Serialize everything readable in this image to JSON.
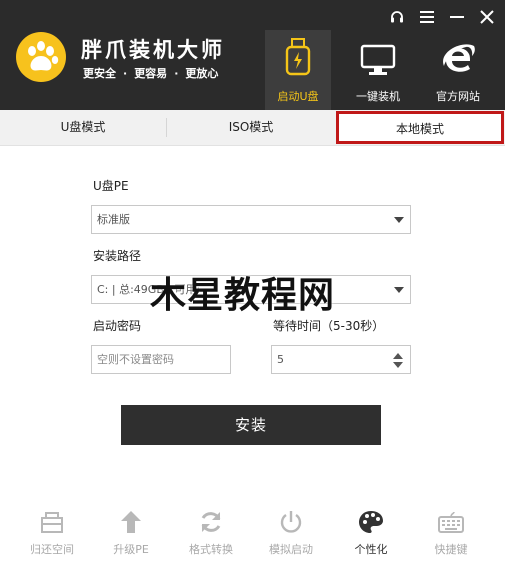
{
  "app": {
    "title": "胖爪装机大师",
    "slogan": [
      "更安全",
      "更容易",
      "更放心"
    ],
    "slogan_separator": "·"
  },
  "window_controls": {
    "support": "headset-icon",
    "menu": "menu-icon",
    "minimize": "minimize-icon",
    "close": "close-icon"
  },
  "nav": [
    {
      "label": "启动U盘",
      "icon": "usb-drive-icon",
      "active": true
    },
    {
      "label": "一键装机",
      "icon": "monitor-icon",
      "active": false
    },
    {
      "label": "官方网站",
      "icon": "ie-browser-icon",
      "active": false
    }
  ],
  "tabs": [
    {
      "label": "U盘模式",
      "active": false
    },
    {
      "label": "ISO模式",
      "active": false
    },
    {
      "label": "本地模式",
      "active": true
    }
  ],
  "form": {
    "pe_label": "U盘PE",
    "pe_value": "标准版",
    "path_label": "安装路径",
    "path_value": "C: | 总:49GB | 可用:",
    "password_label": "启动密码",
    "password_placeholder": "空则不设置密码",
    "wait_label": "等待时间（5-30秒）",
    "wait_value": "5",
    "install_label": "安装"
  },
  "watermark": "木星教程网",
  "toolbar": [
    {
      "label": "归还空间",
      "icon": "hdd-icon",
      "active": false
    },
    {
      "label": "升级PE",
      "icon": "arrow-up-icon",
      "active": false
    },
    {
      "label": "格式转换",
      "icon": "refresh-icon",
      "active": false
    },
    {
      "label": "模拟启动",
      "icon": "power-icon",
      "active": false
    },
    {
      "label": "个性化",
      "icon": "palette-icon",
      "active": true
    },
    {
      "label": "快捷键",
      "icon": "keyboard-icon",
      "active": false
    }
  ],
  "colors": {
    "header_bg": "#2b2b2b",
    "accent_yellow": "#f5c518",
    "active_tab_border": "#c01818",
    "install_button": "#2f2f2f"
  }
}
